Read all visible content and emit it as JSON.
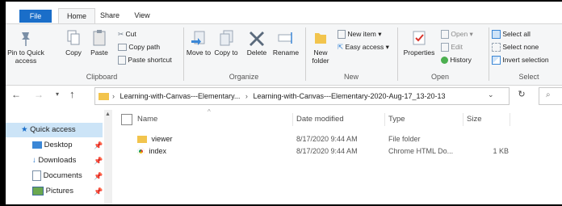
{
  "tabs": {
    "file": "File",
    "home": "Home",
    "share": "Share",
    "view": "View"
  },
  "clipboard": {
    "pin": "Pin to Quick access",
    "copy": "Copy",
    "paste": "Paste",
    "cut": "Cut",
    "copy_path": "Copy path",
    "paste_shortcut": "Paste shortcut",
    "label": "Clipboard"
  },
  "organize": {
    "move_to": "Move to",
    "copy_to": "Copy to",
    "delete": "Delete",
    "rename": "Rename",
    "label": "Organize"
  },
  "new_group": {
    "new_folder": "New folder",
    "new_item": "New item",
    "easy_access": "Easy access",
    "label": "New"
  },
  "open_group": {
    "properties": "Properties",
    "open": "Open",
    "edit": "Edit",
    "history": "History",
    "label": "Open"
  },
  "select_group": {
    "select_all": "Select all",
    "select_none": "Select none",
    "invert": "Invert selection",
    "label": "Select"
  },
  "address": {
    "crumb1": "Learning-with-Canvas---Elementary...",
    "crumb2": "Learning-with-Canvas---Elementary-2020-Aug-17_13-20-13"
  },
  "navpane": {
    "quick_access": "Quick access",
    "items": [
      "Desktop",
      "Downloads",
      "Documents",
      "Pictures"
    ]
  },
  "columns": {
    "name": "Name",
    "date": "Date modified",
    "type": "Type",
    "size": "Size"
  },
  "files": [
    {
      "name": "viewer",
      "date": "8/17/2020 9:44 AM",
      "type": "File folder",
      "size": ""
    },
    {
      "name": "index",
      "date": "8/17/2020 9:44 AM",
      "type": "Chrome HTML Do...",
      "size": "1 KB"
    }
  ],
  "colors": {
    "accent": "#1a6ec9",
    "selection": "#cce4f7",
    "folder": "#f2c44d"
  }
}
